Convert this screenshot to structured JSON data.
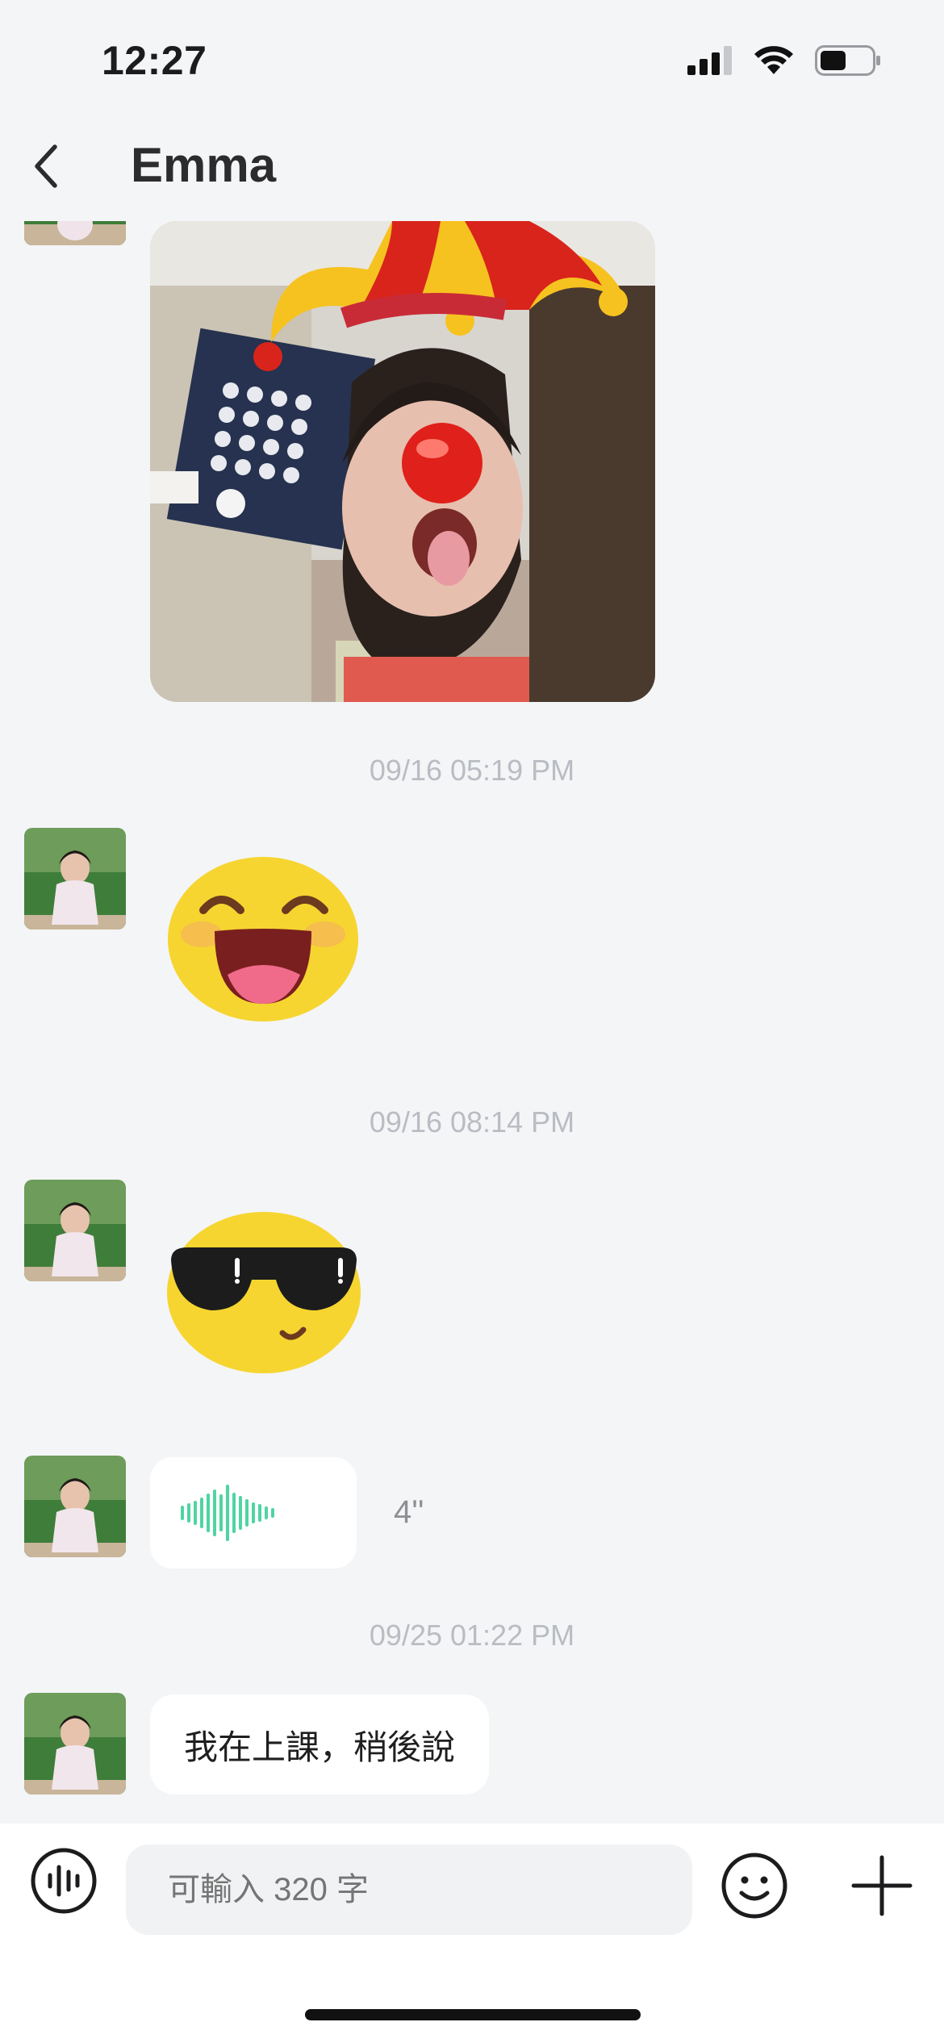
{
  "status_bar": {
    "time": "12:27",
    "battery_level": 0.5
  },
  "header": {
    "title": "Emma"
  },
  "messages": {
    "timestamps": [
      "09/16 05:19 PM",
      "09/16 08:14 PM",
      "09/25 01:22 PM"
    ],
    "voice_duration": "4''",
    "text_message": "我在上課，稍後說"
  },
  "input": {
    "placeholder": "可輸入 320 字"
  },
  "colors": {
    "background": "#f4f5f7",
    "voice_wave": "#4fd4a2",
    "bubble": "#ffffff"
  },
  "icons": [
    "back-chevron-icon",
    "signal-icon",
    "wifi-icon",
    "battery-icon",
    "voice-input-icon",
    "emoji-icon",
    "plus-icon",
    "waveform-icon"
  ]
}
